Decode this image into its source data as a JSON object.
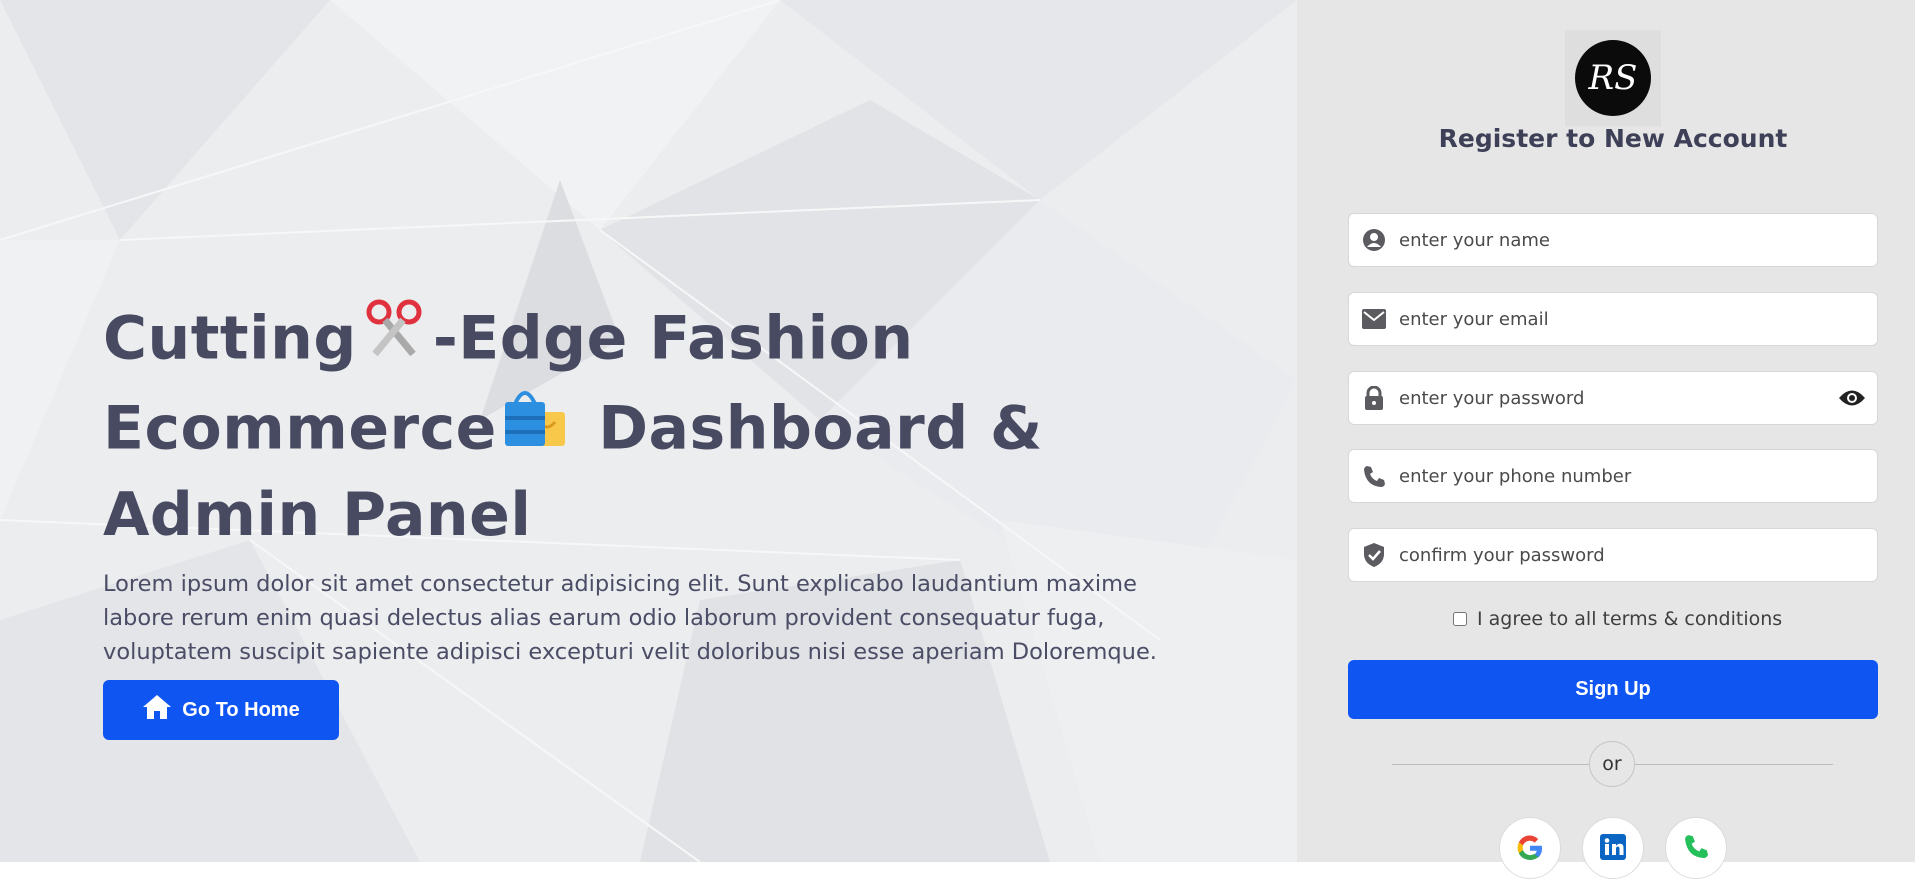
{
  "hero": {
    "title_part1": "Cutting",
    "title_part2": "-Edge Fashion",
    "title_part3": "Ecommerce",
    "title_part4": "Dashboard &",
    "title_part5": "Admin Panel",
    "description": "Lorem ipsum dolor sit amet consectetur adipisicing elit. Sunt explicabo laudantium maxime labore rerum enim quasi delectus alias earum odio laborum provident consequatur fuga, voluptatem suscipit sapiente adipisci excepturi velit doloribus nisi esse aperiam Doloremque.",
    "home_button_label": "Go To Home",
    "home_icon": "home-icon",
    "emoji_1": "scissors-icon",
    "emoji_2": "shopping-bags-icon"
  },
  "register": {
    "logo_text": "RS",
    "title": "Register to New Account",
    "fields": {
      "name_placeholder": "enter your name",
      "email_placeholder": "enter your email",
      "password_placeholder": "enter your password",
      "phone_placeholder": "enter your phone number",
      "confirm_placeholder": "confirm your password"
    },
    "terms_label": "I agree to all terms & conditions",
    "signup_label": "Sign Up",
    "divider_text": "or",
    "social": [
      "google-icon",
      "linkedin-icon",
      "phone-icon"
    ]
  },
  "colors": {
    "accent": "#0f55f2",
    "title": "#484a62",
    "panel_bg": "#e6e6e6"
  }
}
